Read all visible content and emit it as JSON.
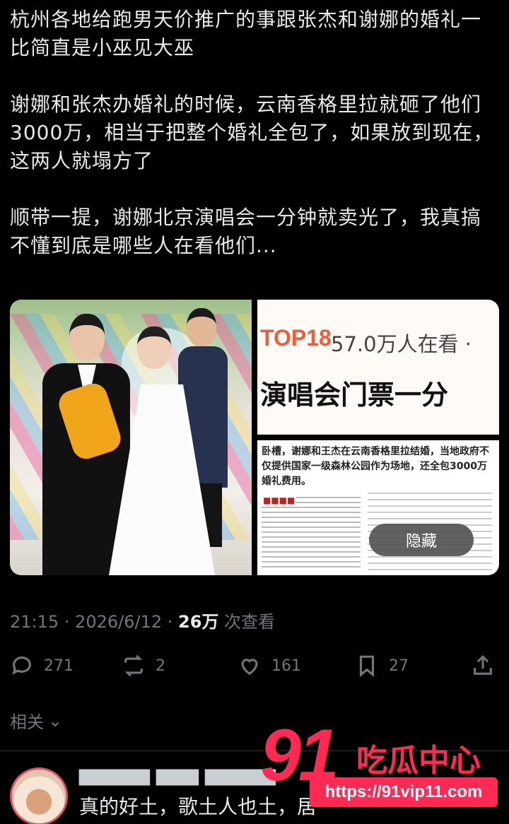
{
  "post": {
    "paragraphs": [
      "杭州各地给跑男天价推广的事跟张杰和谢娜的婚礼一比简直是小巫见大巫",
      "谢娜和张杰办婚礼的时候，云南香格里拉就砸了他们3000万，相当于把整个婚礼全包了，如果放到现在，这两人就塌方了",
      "顺带一提，谢娜北京演唱会一分钟就卖光了，我真搞不懂到底是哪些人在看他们..."
    ]
  },
  "media": {
    "top_right": {
      "rank": "TOP18",
      "watching": "57.0万人在看 ·",
      "headline": "演唱会门票一分"
    },
    "bottom_right": {
      "caption": "卧槽，谢娜和王杰在云南香格里拉结婚，当地政府不仅提供国家一级森林公园作为场地，还全包3000万婚礼费用。",
      "hide_label": "隐藏"
    }
  },
  "meta": {
    "time": "21:15 · 2026/6/12 · ",
    "views": "26万",
    "views_suffix": " 次查看"
  },
  "actions": {
    "replies": "271",
    "reposts": "2",
    "likes": "161",
    "bookmarks": "27"
  },
  "related": {
    "label": "相关"
  },
  "reply": {
    "text": "真的好土，歌土人也土，居"
  },
  "watermark": {
    "number": "91",
    "text": "吃瓜中心",
    "url": "https://91vip11.com"
  },
  "colors": {
    "background": "#000000",
    "text": "#e7e9ea",
    "muted": "#71767b",
    "watermark": "#ff2a54"
  }
}
